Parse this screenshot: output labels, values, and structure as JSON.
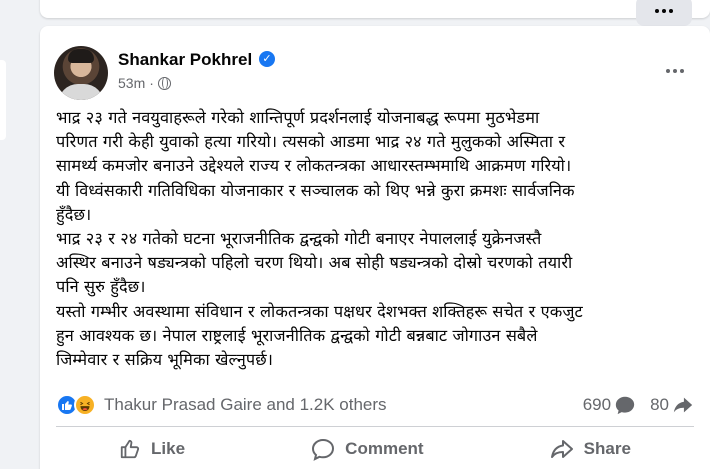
{
  "post": {
    "author": "Shankar Pokhrel",
    "time": "53m",
    "body_lines": [
      "भाद्र २३ गते नवयुवाहरूले गरेको शान्तिपूर्ण प्रदर्शनलाई योजनाबद्ध रूपमा मुठभेडमा",
      "परिणत गरी केही युवाको हत्या गरियो। त्यसको आडमा भाद्र २४ गते मुलुकको अस्मिता र",
      "सामर्थ्य कमजोर बनाउने उद्देश्यले राज्य र लोकतन्त्रका आधारस्तम्भमाथि आक्रमण गरियो।",
      "यी विध्वंसकारी गतिविधिका योजनाकार र सञ्चालक को थिए भन्ने कुरा क्रमशः सार्वजनिक",
      "हुँदैछ।",
      "भाद्र २३ र २४ गतेको घटना भूराजनीतिक द्वन्द्वको गोटी बनाएर नेपाललाई युक्रेनजस्तै",
      "अस्थिर बनाउने षड्यन्त्रको पहिलो चरण थियो। अब सोही षड्यन्त्रको दोस्रो चरणको तयारी",
      "पनि सुरु हुँदैछ।",
      "यस्तो गम्भीर अवस्थामा संविधान र लोकतन्त्रका पक्षधर देशभक्त शक्तिहरू सचेत र एकजुट",
      "हुन आवश्यक छ। नेपाल राष्ट्रलाई भूराजनीतिक द्वन्द्वको गोटी बन्नबाट जोगाउन सबैले",
      "जिम्मेवार र सक्रिय भूमिका खेल्नुपर्छ।"
    ],
    "reactions_text": "Thakur Prasad Gaire and 1.2K others",
    "comments_count": "690",
    "shares_count": "80",
    "actions": {
      "like": "Like",
      "comment": "Comment",
      "share": "Share"
    }
  },
  "icons": {
    "verified": "verified-badge-icon",
    "audience": "globe-icon",
    "more": "more-options-icon",
    "like_reaction": "like-reaction-icon",
    "haha_reaction": "haha-reaction-icon",
    "comment": "comment-bubble-icon",
    "share": "share-arrow-icon",
    "like_action": "thumbs-up-icon"
  },
  "colors": {
    "accent": "#1877f2",
    "secondary_text": "#65676b",
    "background": "#f0f2f5"
  }
}
